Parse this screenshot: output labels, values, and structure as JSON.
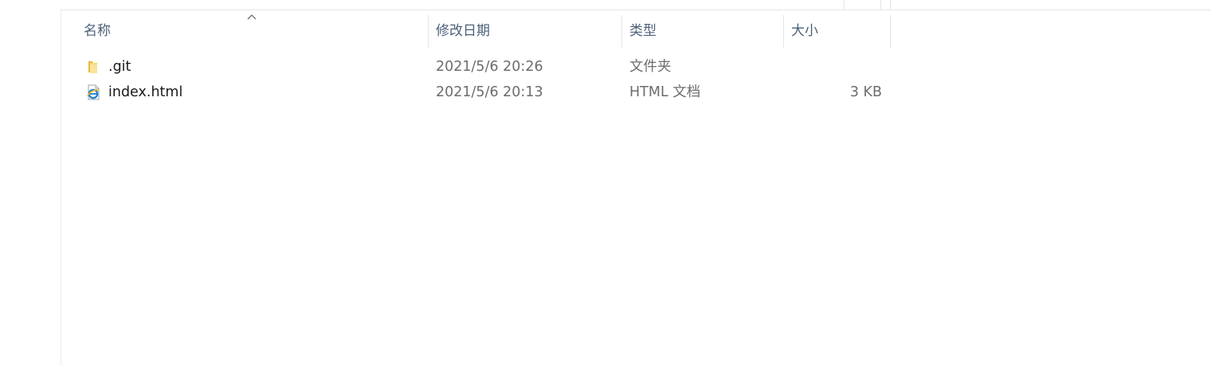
{
  "columns": {
    "name": "名称",
    "date_modified": "修改日期",
    "type": "类型",
    "size": "大小"
  },
  "sort": {
    "column": "name",
    "direction": "ascending",
    "icon": "chevron-up-icon"
  },
  "files": [
    {
      "name": ".git",
      "date_modified": "2021/5/6 20:26",
      "type": "文件夹",
      "size": "",
      "icon": "folder-icon"
    },
    {
      "name": "index.html",
      "date_modified": "2021/5/6 20:13",
      "type": "HTML 文档",
      "size": "3 KB",
      "icon": "internet-explorer-file-icon"
    }
  ],
  "colors": {
    "header_text": "#4c607a",
    "secondary_text": "#6d6d6d",
    "folder_yellow": "#f7d774"
  }
}
